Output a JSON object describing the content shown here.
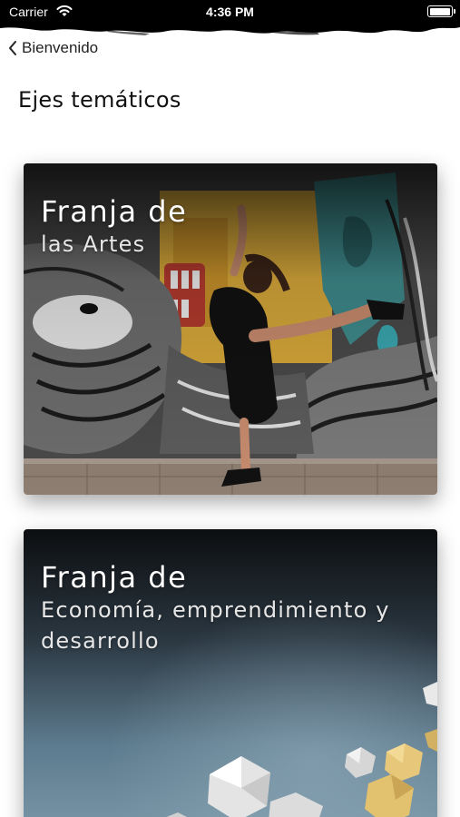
{
  "status_bar": {
    "carrier": "Carrier",
    "time": "4:36 PM",
    "battery_level": 1.0
  },
  "nav": {
    "back_label": "Bienvenido",
    "back_icon": "chevron-left-icon"
  },
  "page": {
    "title": "Ejes temáticos"
  },
  "cards": [
    {
      "heading": "Franja de",
      "subtitle": "las Artes",
      "image": "dancer-in-front-of-graffiti-mural"
    },
    {
      "heading": "Franja de",
      "subtitle": "Economía, emprendimiento y desarrollo",
      "image": "geometric-polyhedra-on-blue-gradient"
    }
  ],
  "colors": {
    "status_bar_bg": "#000000",
    "text_dark": "#111111",
    "card_text": "#ffffff"
  }
}
